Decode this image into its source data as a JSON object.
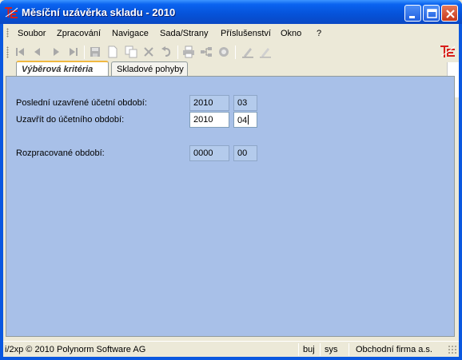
{
  "window": {
    "title": "Měsíční uzávěrka skladu - 2010",
    "app_icon": "TE-logo-icon",
    "controls": [
      "minimize-icon",
      "maximize-icon",
      "close-icon"
    ]
  },
  "menu": {
    "items": [
      "Soubor",
      "Zpracování",
      "Navigace",
      "Sada/Strany",
      "Příslušenství",
      "Okno",
      "?"
    ]
  },
  "toolbar": {
    "icons": [
      "first-record-icon",
      "previous-record-icon",
      "next-record-icon",
      "last-record-icon",
      "save-icon",
      "new-record-icon",
      "copy-record-icon",
      "delete-icon",
      "undo-icon",
      "print-icon",
      "structure-icon",
      "refresh-icon",
      "edit-icon",
      "edit-all-icon"
    ]
  },
  "tabs": [
    {
      "label": "Výběrová kritéria",
      "active": true
    },
    {
      "label": "Skladové pohyby",
      "active": false
    }
  ],
  "form": {
    "last_closed": {
      "label": "Poslední uzavřené účetní období:",
      "year": "2010",
      "month": "03"
    },
    "close_to": {
      "label": "Uzavřít do účetního období:",
      "year": "2010",
      "month": "04"
    },
    "in_progress": {
      "label": "Rozpracované období:",
      "year": "0000",
      "month": "00"
    }
  },
  "status": {
    "copyright": "i/2xp © 2010 Polynorm Software AG",
    "user": "buj",
    "system": "sys",
    "company": "Obchodní firma a.s."
  },
  "colors": {
    "titlebar": "#0552d8",
    "panel": "#a8c0e8",
    "readonly_field": "#b4cbec",
    "chrome": "#ece9d8"
  }
}
